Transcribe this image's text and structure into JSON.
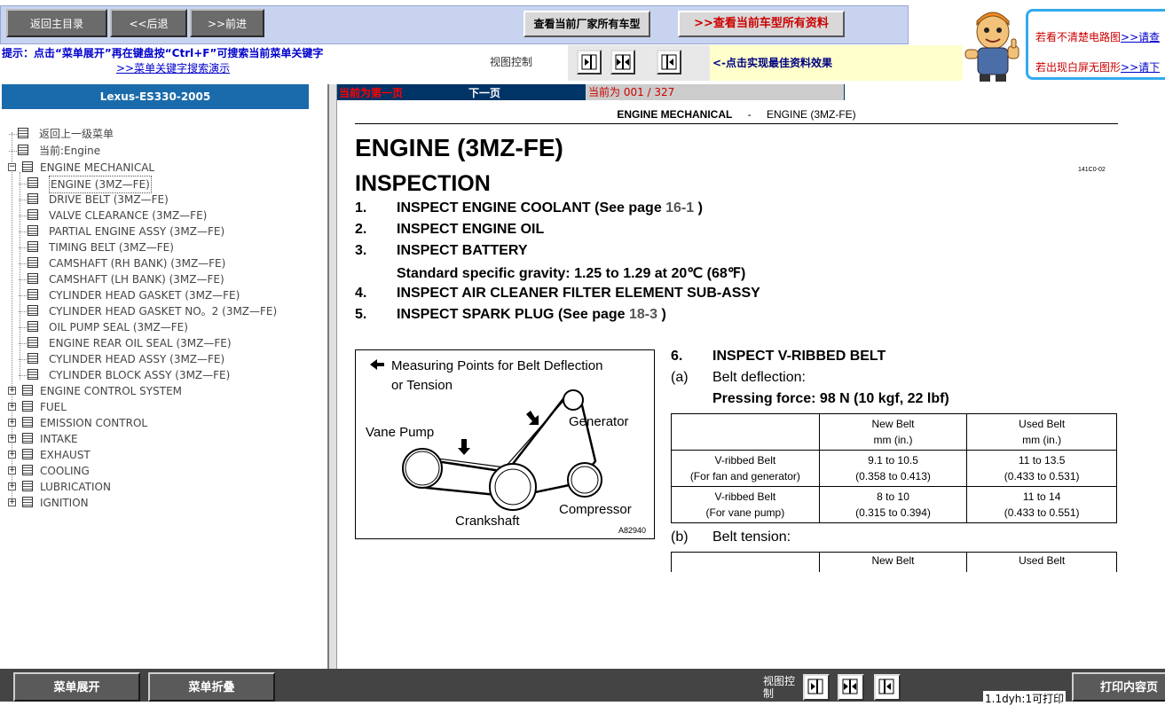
{
  "toolbar": {
    "home_label": "返回主目录",
    "back_label": "<<后退",
    "forward_label": ">>前进",
    "all_models_label": "查看当前厂家所有车型",
    "all_docs_label": ">>查看当前车型所有资料"
  },
  "tips": {
    "hint": "提示：点击“菜单展开”再在键盘按“Ctrl+F”可搜索当前菜单关键字",
    "demo_link": ">>菜单关键字搜索演示",
    "view_control": "视图控制",
    "best_effect": "<-点击实现最佳资料效果"
  },
  "help": {
    "line1_text": "若看不清楚电路图",
    "line1_link": ">>请查",
    "line2_text": "若出现白屏无图形",
    "line2_link": ">>请下"
  },
  "sidebar": {
    "model": "Lexus-ES330-2005",
    "back_up": "返回上一级菜单",
    "current": "当前:Engine",
    "groups": [
      {
        "label": "ENGINE MECHANICAL",
        "expanded": true,
        "children": [
          "ENGINE (3MZ—FE)",
          "DRIVE BELT (3MZ—FE)",
          "VALVE CLEARANCE (3MZ—FE)",
          "PARTIAL ENGINE ASSY (3MZ—FE)",
          "TIMING BELT (3MZ—FE)",
          "CAMSHAFT (RH BANK) (3MZ—FE)",
          "CAMSHAFT (LH BANK) (3MZ—FE)",
          "CYLINDER HEAD GASKET (3MZ—FE)",
          "CYLINDER HEAD GASKET NO。2 (3MZ—FE)",
          "OIL PUMP SEAL (3MZ—FE)",
          "ENGINE REAR OIL SEAL (3MZ—FE)",
          "CYLINDER HEAD ASSY (3MZ—FE)",
          "CYLINDER BLOCK ASSY (3MZ—FE)"
        ]
      },
      {
        "label": "ENGINE CONTROL SYSTEM",
        "expanded": false
      },
      {
        "label": "FUEL",
        "expanded": false
      },
      {
        "label": "EMISSION CONTROL",
        "expanded": false
      },
      {
        "label": "INTAKE",
        "expanded": false
      },
      {
        "label": "EXHAUST",
        "expanded": false
      },
      {
        "label": "COOLING",
        "expanded": false
      },
      {
        "label": "LUBRICATION",
        "expanded": false
      },
      {
        "label": "IGNITION",
        "expanded": false
      }
    ]
  },
  "pager": {
    "first": "当前为第一页",
    "next": "下一页",
    "indicator": "当前为  001 / 327"
  },
  "doc": {
    "header_left": "ENGINE MECHANICAL",
    "header_sep": "-",
    "header_right": "ENGINE (3MZ-FE)",
    "title": "ENGINE (3MZ-FE)",
    "code": "141C0-02",
    "subtitle": "INSPECTION",
    "steps": [
      {
        "n": "1.",
        "t": "INSPECT ENGINE COOLANT (See page ",
        "ref": "16-1",
        "end": " )"
      },
      {
        "n": "2.",
        "t": "INSPECT ENGINE OIL"
      },
      {
        "n": "3.",
        "t": "INSPECT BATTERY"
      },
      {
        "n": "",
        "t": "Standard specific gravity: 1.25 to 1.29 at 20℃ (68℉)"
      },
      {
        "n": "4.",
        "t": "INSPECT AIR CLEANER FILTER ELEMENT SUB-ASSY"
      },
      {
        "n": "5.",
        "t": "INSPECT SPARK PLUG (See page ",
        "ref": "18-3",
        "end": " )"
      }
    ],
    "figure": {
      "legend_line1": "Measuring Points for Belt Deflection",
      "legend_line2": "or Tension",
      "vane_pump": "Vane Pump",
      "generator": "Generator",
      "crankshaft": "Crankshaft",
      "compressor": "Compressor",
      "fig_id": "A82940"
    },
    "step6": {
      "n": "6.",
      "title": "INSPECT V-RIBBED BELT",
      "a_n": "(a)",
      "a_t": "Belt deflection:",
      "force": "Pressing force: 98 N (10 kgf, 22 lbf)",
      "table_head": [
        "",
        "New Belt\nmm (in.)",
        "Used Belt\nmm (in.)"
      ],
      "table_rows": [
        [
          "V-ribbed Belt\n(For fan and generator)",
          "9.1 to 10.5\n(0.358 to 0.413)",
          "11 to 13.5\n(0.433 to 0.531)"
        ],
        [
          "V-ribbed Belt\n(For vane pump)",
          "8 to 10\n(0.315 to 0.394)",
          "11 to 14\n(0.433 to 0.551)"
        ]
      ],
      "b_n": "(b)",
      "b_t": "Belt tension:",
      "table2_head": [
        "",
        "New Belt",
        "Used Belt"
      ]
    }
  },
  "bottom": {
    "expand_label": "菜单展开",
    "collapse_label": "菜单折叠",
    "view_control": "视图控制",
    "status": "1.1dyh:1可打印",
    "print_label": "打印内容页"
  },
  "colors": {
    "accent_blue": "#1a6bab",
    "nav_bar": "#003366",
    "link_blue": "#0000cc",
    "alert_red": "#cc0000"
  }
}
